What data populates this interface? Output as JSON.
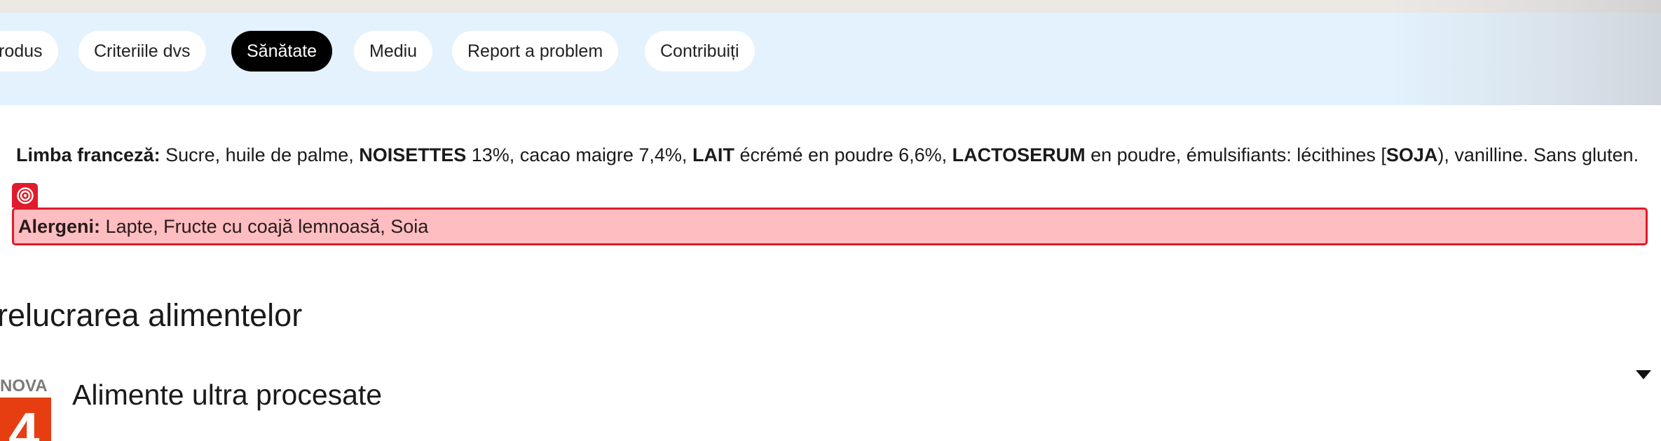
{
  "tabs": [
    {
      "label": "rodus",
      "active": false
    },
    {
      "label": "Criteriile dvs",
      "active": false
    },
    {
      "label": "Sănătate",
      "active": true
    },
    {
      "label": "Mediu",
      "active": false
    },
    {
      "label": "Report a problem",
      "active": false
    },
    {
      "label": "Contribuiți",
      "active": false
    }
  ],
  "ingredients": {
    "label": "Limba franceză:",
    "parts": [
      " Sucre, huile de palme, ",
      "NOISETTES",
      " 13%, cacao maigre 7,4%, ",
      "LAIT",
      " écrémé en poudre 6,6%, ",
      "LACTOSERUM",
      " en poudre, émulsifiants: lécithines [",
      "SOJA",
      "), vanilline. Sans gluten."
    ]
  },
  "allergens": {
    "label": "Alergeni:",
    "value": "Lapte, Fructe cu coajă lemnoasă, Soia"
  },
  "section": {
    "title": "relucrarea alimentelor"
  },
  "nova": {
    "label": "NOVA",
    "group": "4",
    "title": "Alimente ultra procesate"
  },
  "colors": {
    "tabbar_bg": "#e3f2fd",
    "active_tab": "#000000",
    "highlight_bg": "#fdbdc1",
    "highlight_border": "#e01b2c",
    "nova4": "#e63e11"
  },
  "icons": {
    "target": "target-icon",
    "expand": "chevron-down-icon"
  }
}
